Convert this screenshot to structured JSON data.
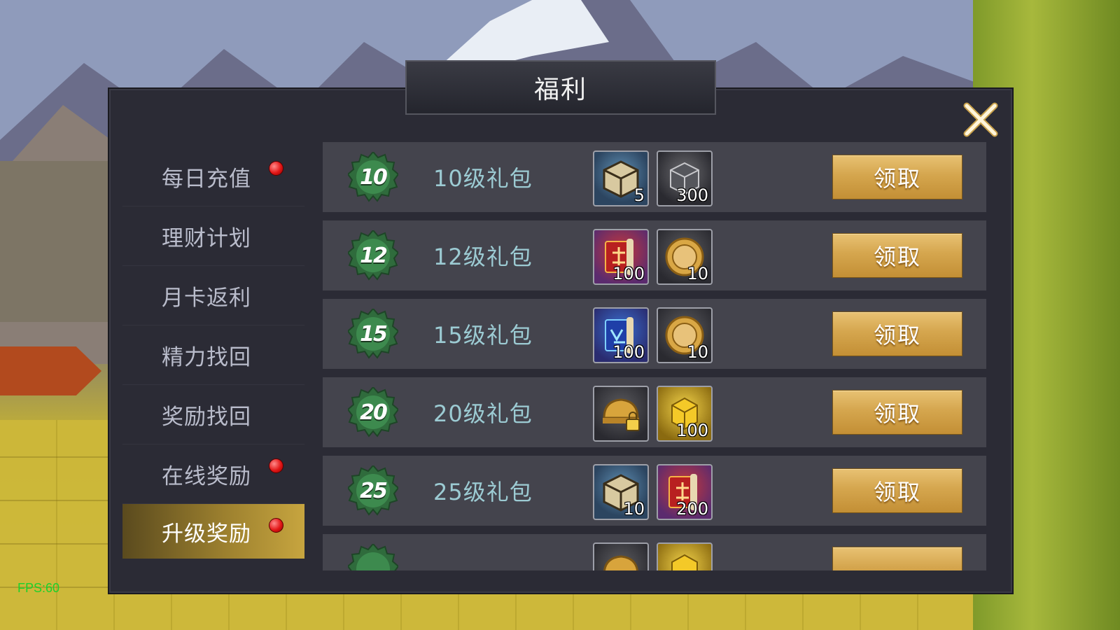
{
  "window": {
    "title": "福利",
    "fps": "FPS:60"
  },
  "sidebar": {
    "items": [
      {
        "label": "每日充值",
        "dot": true,
        "active": false
      },
      {
        "label": "理财计划",
        "dot": false,
        "active": false
      },
      {
        "label": "月卡返利",
        "dot": false,
        "active": false
      },
      {
        "label": "精力找回",
        "dot": false,
        "active": false
      },
      {
        "label": "奖励找回",
        "dot": false,
        "active": false
      },
      {
        "label": "在线奖励",
        "dot": true,
        "active": false
      },
      {
        "label": "升级奖励",
        "dot": true,
        "active": true
      }
    ]
  },
  "rewards": [
    {
      "level": "10",
      "name": "10级礼包",
      "items": [
        {
          "icon": "treasure-box-icon",
          "qty": "5"
        },
        {
          "icon": "iron-cube-icon",
          "qty": "300"
        }
      ],
      "button": "领取"
    },
    {
      "level": "12",
      "name": "12级礼包",
      "items": [
        {
          "icon": "red-scroll-icon",
          "qty": "100"
        },
        {
          "icon": "gold-coin-icon",
          "qty": "10"
        }
      ],
      "button": "领取"
    },
    {
      "level": "15",
      "name": "15级礼包",
      "items": [
        {
          "icon": "blue-scroll-icon",
          "qty": "100"
        },
        {
          "icon": "gold-coin-icon",
          "qty": "10"
        }
      ],
      "button": "领取"
    },
    {
      "level": "20",
      "name": "20级礼包",
      "items": [
        {
          "icon": "locked-helmet-icon",
          "qty": ""
        },
        {
          "icon": "gold-cube-icon",
          "qty": "100"
        }
      ],
      "button": "领取"
    },
    {
      "level": "25",
      "name": "25级礼包",
      "items": [
        {
          "icon": "treasure-box-icon",
          "qty": "10"
        },
        {
          "icon": "red-scroll-icon",
          "qty": "200"
        }
      ],
      "button": "领取"
    },
    {
      "level": "",
      "name": "",
      "items": [
        {
          "icon": "locked-helmet-icon",
          "qty": ""
        },
        {
          "icon": "gold-cube-icon",
          "qty": ""
        }
      ],
      "button": ""
    }
  ],
  "colors": {
    "panel": "#2b2b35",
    "row": "#44444d",
    "button_gold": "#d5a64e",
    "badge_green": "#2f6b3c",
    "level_text": "#9ccbd3",
    "fps": "#1bd12b"
  }
}
